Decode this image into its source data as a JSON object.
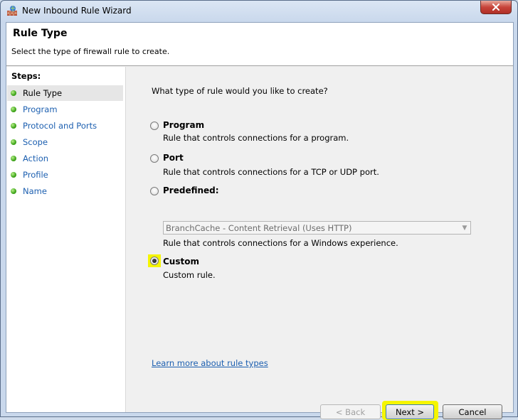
{
  "window": {
    "title": "New Inbound Rule Wizard"
  },
  "header": {
    "title": "Rule Type",
    "subtitle": "Select the type of firewall rule to create."
  },
  "steps": {
    "label": "Steps:",
    "items": [
      {
        "label": "Rule Type",
        "active": true
      },
      {
        "label": "Program",
        "active": false
      },
      {
        "label": "Protocol and Ports",
        "active": false
      },
      {
        "label": "Scope",
        "active": false
      },
      {
        "label": "Action",
        "active": false
      },
      {
        "label": "Profile",
        "active": false
      },
      {
        "label": "Name",
        "active": false
      }
    ]
  },
  "main": {
    "question": "What type of rule would you like to create?",
    "options": [
      {
        "label": "Program",
        "description": "Rule that controls connections for a program.",
        "checked": false
      },
      {
        "label": "Port",
        "description": "Rule that controls connections for a TCP or UDP port.",
        "checked": false
      },
      {
        "label": "Predefined:",
        "description": "Rule that controls connections for a Windows experience.",
        "checked": false
      },
      {
        "label": "Custom",
        "description": "Custom rule.",
        "checked": true
      }
    ],
    "predefined_select": {
      "value": "BranchCache - Content Retrieval (Uses HTTP)",
      "enabled": false
    },
    "learn_more": "Learn more about rule types"
  },
  "buttons": {
    "back": "< Back",
    "next": "Next >",
    "cancel": "Cancel"
  },
  "colors": {
    "highlight": "#f5f500",
    "link": "#1c5fb0",
    "step_dot": "#3ea51a",
    "close": "#c7443a"
  }
}
